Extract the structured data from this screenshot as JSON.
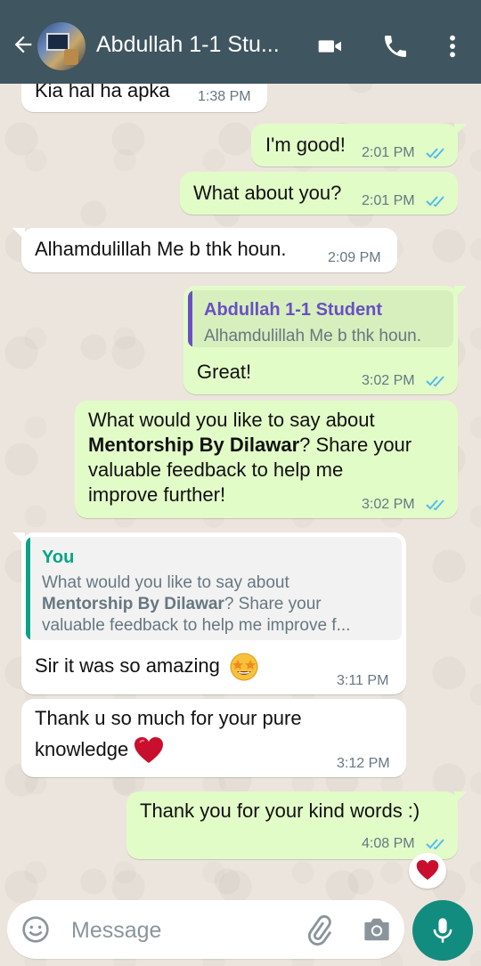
{
  "header": {
    "contact_name": "Abdullah 1-1 Stu...",
    "colors": {
      "bar": "#3f5560"
    }
  },
  "messages": [
    {
      "id": "m0",
      "direction": "in",
      "text": "Kia hal ha apka",
      "time": "1:38 PM"
    },
    {
      "id": "m1",
      "direction": "out",
      "text": "I'm good!",
      "time": "2:01 PM",
      "status": "read"
    },
    {
      "id": "m2",
      "direction": "out",
      "text": "What about you?",
      "time": "2:01 PM",
      "status": "read"
    },
    {
      "id": "m3",
      "direction": "in",
      "text": "Alhamdulillah Me b thk houn.",
      "time": "2:09 PM"
    },
    {
      "id": "m4",
      "direction": "out",
      "quote": {
        "author": "Abdullah 1-1 Student",
        "text": "Alhamdulillah Me b thk houn."
      },
      "text": "Great!",
      "time": "3:02 PM",
      "status": "read"
    },
    {
      "id": "m5",
      "direction": "out",
      "lines": [
        "What would you like to say about",
        "Share your",
        "valuable feedback to help me",
        "improve further!"
      ],
      "bold": "Mentorship By Dilawar",
      "bold_suffix": "? Share your",
      "time": "3:02 PM",
      "status": "read"
    },
    {
      "id": "m6",
      "direction": "in",
      "quote": {
        "author": "You",
        "line1": "What would you like to say about",
        "bold": "Mentorship By Dilawar",
        "line2_suffix": "? Share your",
        "line3": "valuable feedback to help me improve f..."
      },
      "text": "Sir it was so amazing",
      "emoji": "star-struck",
      "time": "3:11 PM"
    },
    {
      "id": "m7",
      "direction": "in",
      "line1": "Thank u so much for your pure",
      "line2": "knowledge",
      "emoji": "red-heart",
      "time": "3:12 PM"
    },
    {
      "id": "m8",
      "direction": "out",
      "text": "Thank you for your kind words :)",
      "time": "4:08 PM",
      "status": "read",
      "reaction": "red-heart"
    }
  ],
  "composer": {
    "placeholder": "Message"
  },
  "colors": {
    "outgoing_bubble": "#e2fcc8",
    "incoming_bubble": "#ffffff",
    "read_ticks": "#53bdeb",
    "quote_author_out": "#6a4fc5",
    "quote_author_in": "#06a386",
    "mic": "#128c7e"
  }
}
